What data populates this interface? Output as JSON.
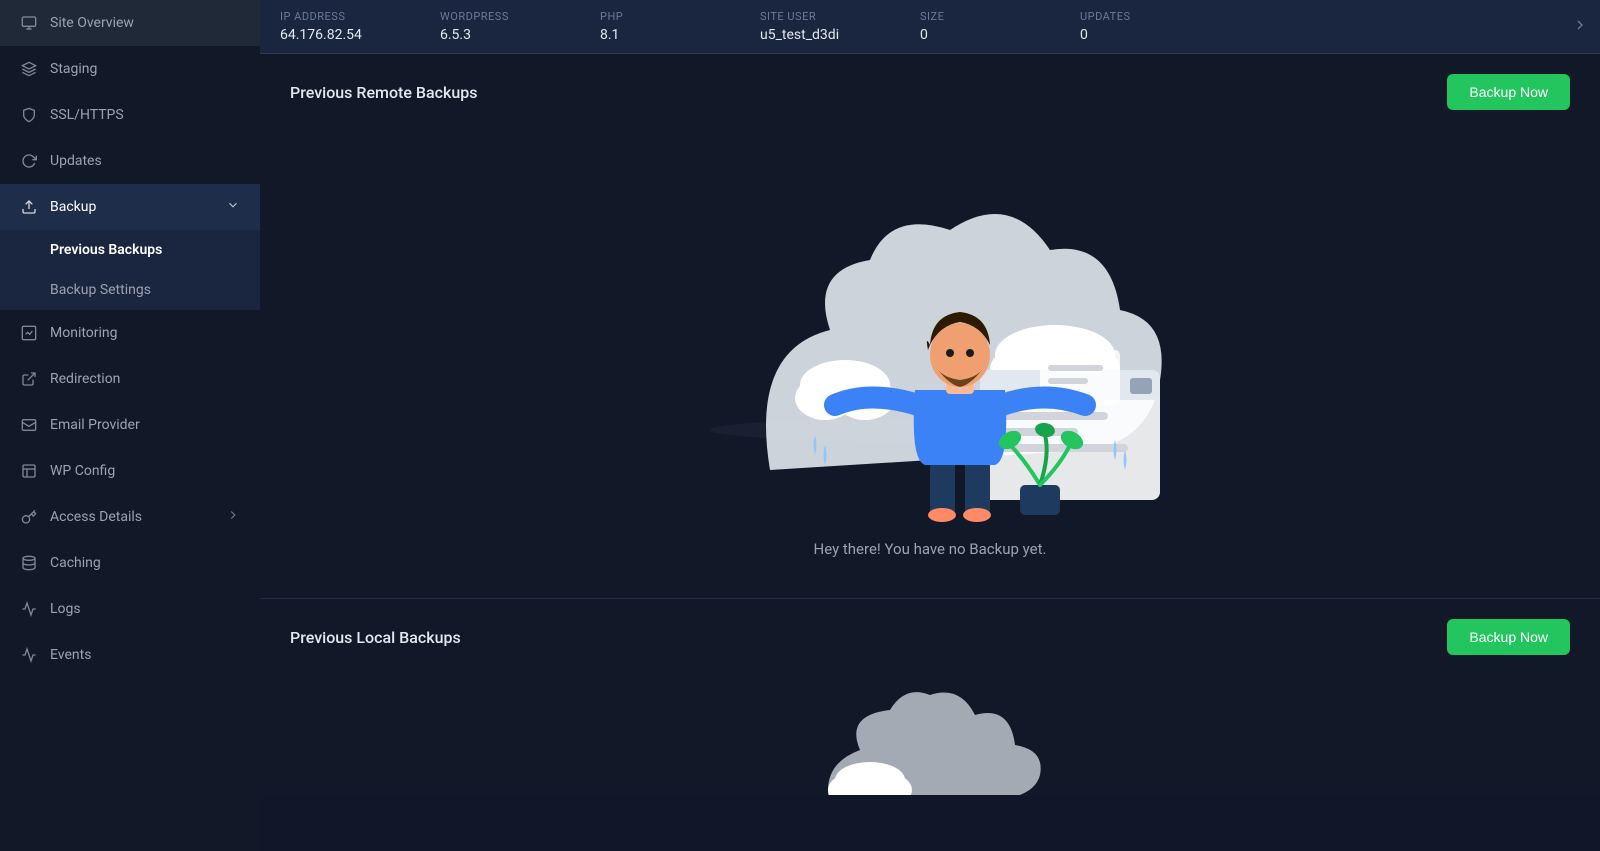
{
  "sidebar": {
    "items": [
      {
        "id": "site-overview",
        "label": "Site Overview",
        "icon": "monitor",
        "active": false
      },
      {
        "id": "staging",
        "label": "Staging",
        "icon": "layers",
        "active": false
      },
      {
        "id": "ssl-https",
        "label": "SSL/HTTPS",
        "icon": "shield",
        "active": false
      },
      {
        "id": "updates",
        "label": "Updates",
        "icon": "refresh",
        "active": false
      },
      {
        "id": "backup",
        "label": "Backup",
        "icon": "backup",
        "active": true,
        "expanded": true
      },
      {
        "id": "monitoring",
        "label": "Monitoring",
        "icon": "monitoring",
        "active": false
      },
      {
        "id": "redirection",
        "label": "Redirection",
        "icon": "redirect",
        "active": false
      },
      {
        "id": "email-provider",
        "label": "Email Provider",
        "icon": "email",
        "active": false
      },
      {
        "id": "wp-config",
        "label": "WP Config",
        "icon": "wpconfig",
        "active": false
      },
      {
        "id": "access-details",
        "label": "Access Details",
        "icon": "key",
        "active": false,
        "hasSubmenu": true
      },
      {
        "id": "caching",
        "label": "Caching",
        "icon": "caching",
        "active": false
      },
      {
        "id": "logs",
        "label": "Logs",
        "icon": "logs",
        "active": false
      },
      {
        "id": "events",
        "label": "Events",
        "icon": "events",
        "active": false
      }
    ],
    "backup_submenu": [
      {
        "id": "previous-backups",
        "label": "Previous Backups",
        "active": true
      },
      {
        "id": "backup-settings",
        "label": "Backup Settings",
        "active": false
      }
    ]
  },
  "topbar": {
    "columns": [
      {
        "id": "ip-address",
        "label": "IP ADDRESS",
        "value": "64.176.82.54"
      },
      {
        "id": "wordpress",
        "label": "WORDPRESS",
        "value": "6.5.3"
      },
      {
        "id": "php",
        "label": "PHP",
        "value": "8.1"
      },
      {
        "id": "site-user",
        "label": "SITE USER",
        "value": "u5_test_d3di"
      },
      {
        "id": "size",
        "label": "SIZE",
        "value": "0"
      },
      {
        "id": "updates",
        "label": "UPDATES",
        "value": "0"
      }
    ]
  },
  "remote_backup": {
    "title": "Previous Remote Backups",
    "backup_btn": "Backup Now",
    "empty_text": "Hey there! You have no Backup yet."
  },
  "local_backup": {
    "title": "Previous Local Backups",
    "backup_btn": "Backup Now"
  }
}
